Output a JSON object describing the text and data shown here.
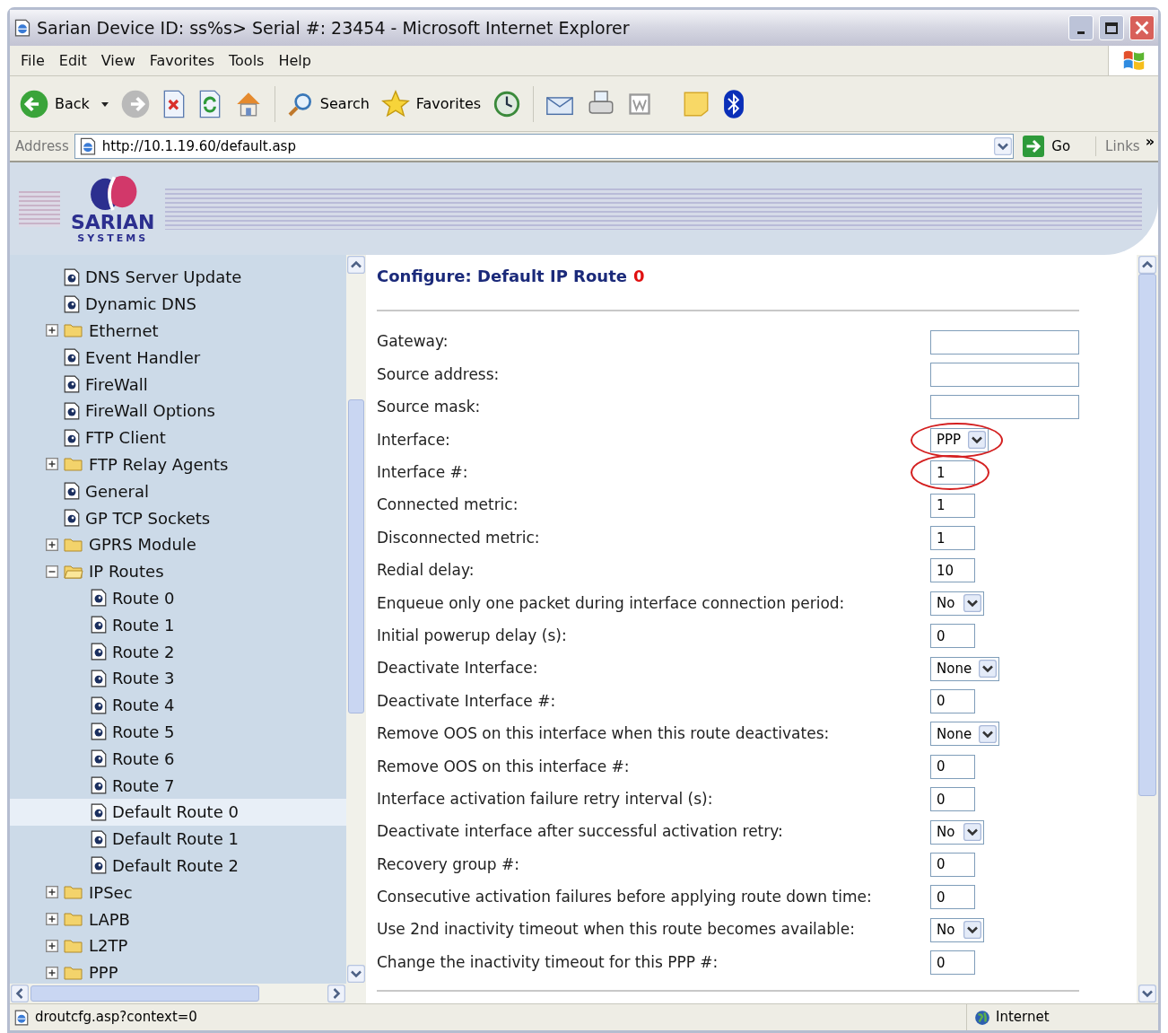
{
  "window": {
    "title": "Sarian Device ID: ss%s> Serial #: 23454 - Microsoft Internet Explorer"
  },
  "menu": [
    "File",
    "Edit",
    "View",
    "Favorites",
    "Tools",
    "Help"
  ],
  "toolbar": {
    "back": "Back",
    "search": "Search",
    "favorites": "Favorites"
  },
  "address_bar": {
    "label": "Address",
    "url": "http://10.1.19.60/default.asp",
    "go": "Go",
    "links": "Links",
    "more": "»"
  },
  "banner": {
    "logo_name": "SARIAN",
    "logo_sub": "SYSTEMS"
  },
  "tree": [
    {
      "label": "DNS Server Update",
      "kind": "page",
      "selected": false
    },
    {
      "label": "Dynamic DNS",
      "kind": "page",
      "selected": false
    },
    {
      "label": "Ethernet",
      "kind": "folder",
      "expanded": false,
      "selected": false
    },
    {
      "label": "Event Handler",
      "kind": "page",
      "selected": false
    },
    {
      "label": "FireWall",
      "kind": "page",
      "selected": false
    },
    {
      "label": "FireWall Options",
      "kind": "page",
      "selected": false
    },
    {
      "label": "FTP Client",
      "kind": "page",
      "selected": false
    },
    {
      "label": "FTP Relay Agents",
      "kind": "folder",
      "expanded": false,
      "selected": false
    },
    {
      "label": "General",
      "kind": "page",
      "selected": false
    },
    {
      "label": "GP TCP Sockets",
      "kind": "page",
      "selected": false
    },
    {
      "label": "GPRS Module",
      "kind": "folder",
      "expanded": false,
      "selected": false
    },
    {
      "label": "IP Routes",
      "kind": "folder",
      "expanded": true,
      "selected": false,
      "children": [
        {
          "label": "Route 0",
          "kind": "page",
          "selected": false
        },
        {
          "label": "Route 1",
          "kind": "page",
          "selected": false
        },
        {
          "label": "Route 2",
          "kind": "page",
          "selected": false
        },
        {
          "label": "Route 3",
          "kind": "page",
          "selected": false
        },
        {
          "label": "Route 4",
          "kind": "page",
          "selected": false
        },
        {
          "label": "Route 5",
          "kind": "page",
          "selected": false
        },
        {
          "label": "Route 6",
          "kind": "page",
          "selected": false
        },
        {
          "label": "Route 7",
          "kind": "page",
          "selected": false
        },
        {
          "label": "Default Route 0",
          "kind": "page",
          "selected": true
        },
        {
          "label": "Default Route 1",
          "kind": "page",
          "selected": false
        },
        {
          "label": "Default Route 2",
          "kind": "page",
          "selected": false
        }
      ]
    },
    {
      "label": "IPSec",
      "kind": "folder",
      "expanded": false,
      "selected": false
    },
    {
      "label": "LAPB",
      "kind": "folder",
      "expanded": false,
      "selected": false
    },
    {
      "label": "L2TP",
      "kind": "folder",
      "expanded": false,
      "selected": false
    },
    {
      "label": "PPP",
      "kind": "folder",
      "expanded": false,
      "selected": false
    }
  ],
  "form": {
    "title": "Configure: Default IP Route",
    "route_number": "0",
    "rows": [
      {
        "label": "Gateway:",
        "kind": "address",
        "highlighted": false
      },
      {
        "label": "Source address:",
        "kind": "address",
        "highlighted": false
      },
      {
        "label": "Source mask:",
        "kind": "address",
        "highlighted": false
      },
      {
        "label": "Interface:",
        "kind": "select",
        "value": "PPP",
        "highlighted": true
      },
      {
        "label": "Interface #:",
        "kind": "number",
        "value": "1",
        "highlighted": true
      },
      {
        "label": "Connected metric:",
        "kind": "number",
        "value": "1",
        "highlighted": false
      },
      {
        "label": "Disconnected metric:",
        "kind": "number",
        "value": "1",
        "highlighted": false
      },
      {
        "label": "Redial delay:",
        "kind": "number",
        "value": "10",
        "highlighted": false
      },
      {
        "label": "Enqueue only one packet during interface connection period:",
        "kind": "select",
        "value": "No",
        "highlighted": false
      },
      {
        "label": "Initial powerup delay (s):",
        "kind": "number",
        "value": "0",
        "highlighted": false
      },
      {
        "label": "Deactivate Interface:",
        "kind": "select",
        "value": "None",
        "highlighted": false
      },
      {
        "label": "Deactivate Interface #:",
        "kind": "number",
        "value": "0",
        "highlighted": false
      },
      {
        "label": "Remove OOS on this interface when this route deactivates:",
        "kind": "select",
        "value": "None",
        "highlighted": false
      },
      {
        "label": "Remove OOS on this interface #:",
        "kind": "number",
        "value": "0",
        "highlighted": false
      },
      {
        "label": "Interface activation failure retry interval (s):",
        "kind": "number",
        "value": "0",
        "highlighted": false
      },
      {
        "label": "Deactivate interface after successful activation retry:",
        "kind": "select",
        "value": "No",
        "highlighted": false
      },
      {
        "label": "Recovery group #:",
        "kind": "number",
        "value": "0",
        "highlighted": false
      },
      {
        "label": "Consecutive activation failures before applying route down time:",
        "kind": "number",
        "value": "0",
        "highlighted": false
      },
      {
        "label": "Use 2nd inactivity timeout when this route becomes available:",
        "kind": "select",
        "value": "No",
        "highlighted": false
      },
      {
        "label": "Change the inactivity timeout for this PPP #:",
        "kind": "number",
        "value": "0",
        "highlighted": false
      }
    ]
  },
  "status_bar": {
    "text": "droutcfg.asp?context=0",
    "zone": "Internet"
  }
}
